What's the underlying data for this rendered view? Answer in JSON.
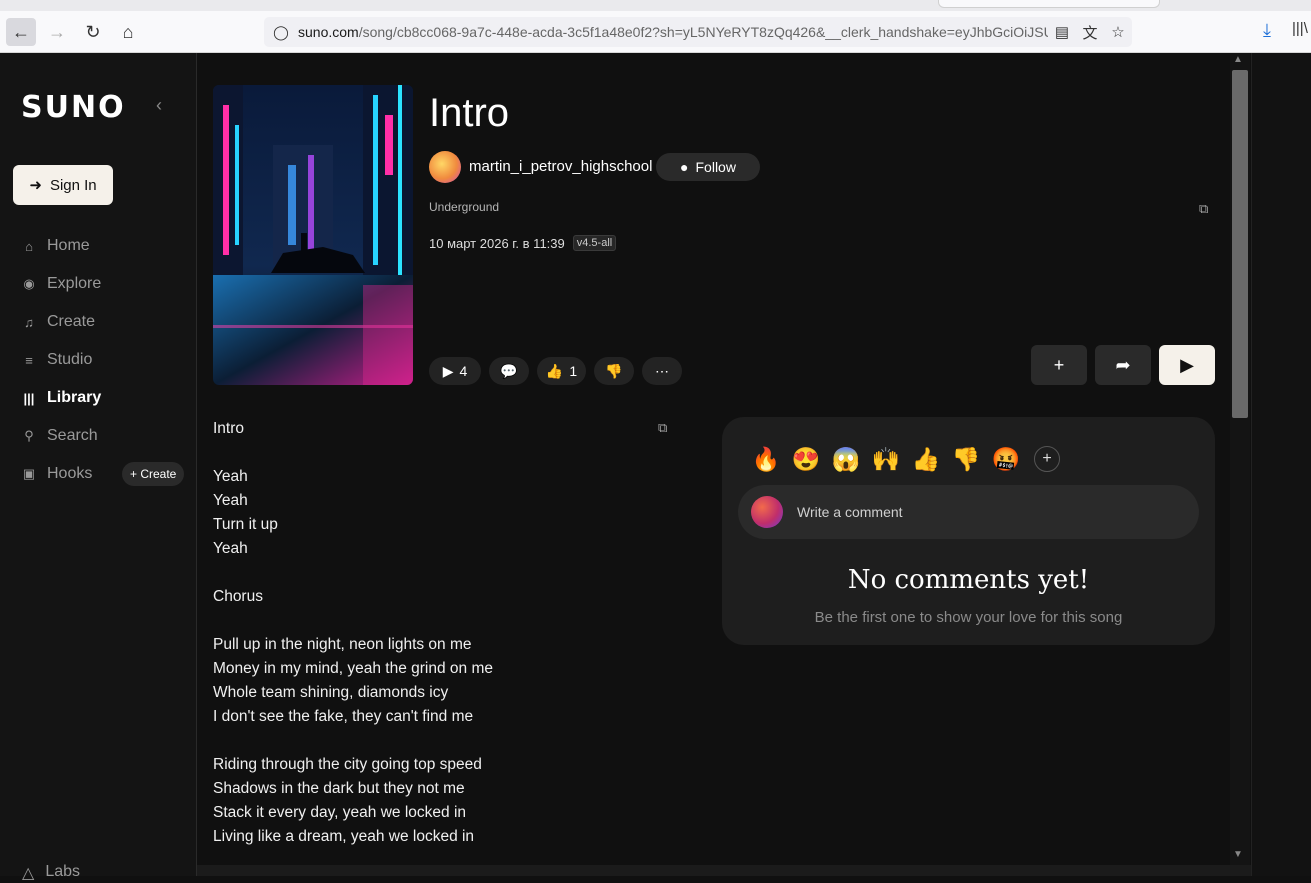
{
  "browser": {
    "url_host": "suno.com",
    "url_path": "/song/cb8cc068-9a7c-448e-acda-3c5f1a48e0f2?sh=yL5NYeRYT8zQq426&__clerk_handshake=eyJhbGciOiJSUzI1N"
  },
  "sidebar": {
    "logo": "SUNO",
    "signin_label": "Sign In",
    "items": [
      {
        "label": "Home",
        "icon": "home-icon"
      },
      {
        "label": "Explore",
        "icon": "compass-icon"
      },
      {
        "label": "Create",
        "icon": "music-note-icon"
      },
      {
        "label": "Studio",
        "icon": "sliders-icon"
      },
      {
        "label": "Library",
        "icon": "library-icon"
      },
      {
        "label": "Search",
        "icon": "search-icon"
      },
      {
        "label": "Hooks",
        "icon": "hooks-icon"
      }
    ],
    "hooks_create_label": "+ Create",
    "labs_label": "Labs"
  },
  "song": {
    "title": "Intro",
    "artist": "martin_i_petrov_highschool",
    "follow_label": "Follow",
    "genre": "Underground",
    "date": "10 март 2026 г. в 11:39",
    "version": "v4.5-all",
    "play_count": "4",
    "like_count": "1"
  },
  "lyrics": [
    "Intro",
    "",
    "Yeah",
    "Yeah",
    "Turn it up",
    "Yeah",
    "",
    "Chorus",
    "",
    "Pull up in the night, neon lights on me",
    "Money in my mind, yeah the grind on me",
    "Whole team shining, diamonds icy",
    "I don't see the fake, they can't find me",
    "",
    "Riding through the city going top speed",
    "Shadows in the dark but they not me",
    "Stack it every day, yeah we locked in",
    "Living like a dream, yeah we locked in"
  ],
  "comments": {
    "reactions": [
      "🔥",
      "😍",
      "😱",
      "🙌",
      "👍",
      "👎",
      "🤬"
    ],
    "placeholder": "Write a comment",
    "empty_title": "No comments yet!",
    "empty_subtitle": "Be the first one to show your love for this song"
  },
  "colors": {
    "background": "#101010",
    "sidebar": "#141414",
    "accent_button": "#f5f1ea",
    "panel": "#1e1e1e"
  }
}
